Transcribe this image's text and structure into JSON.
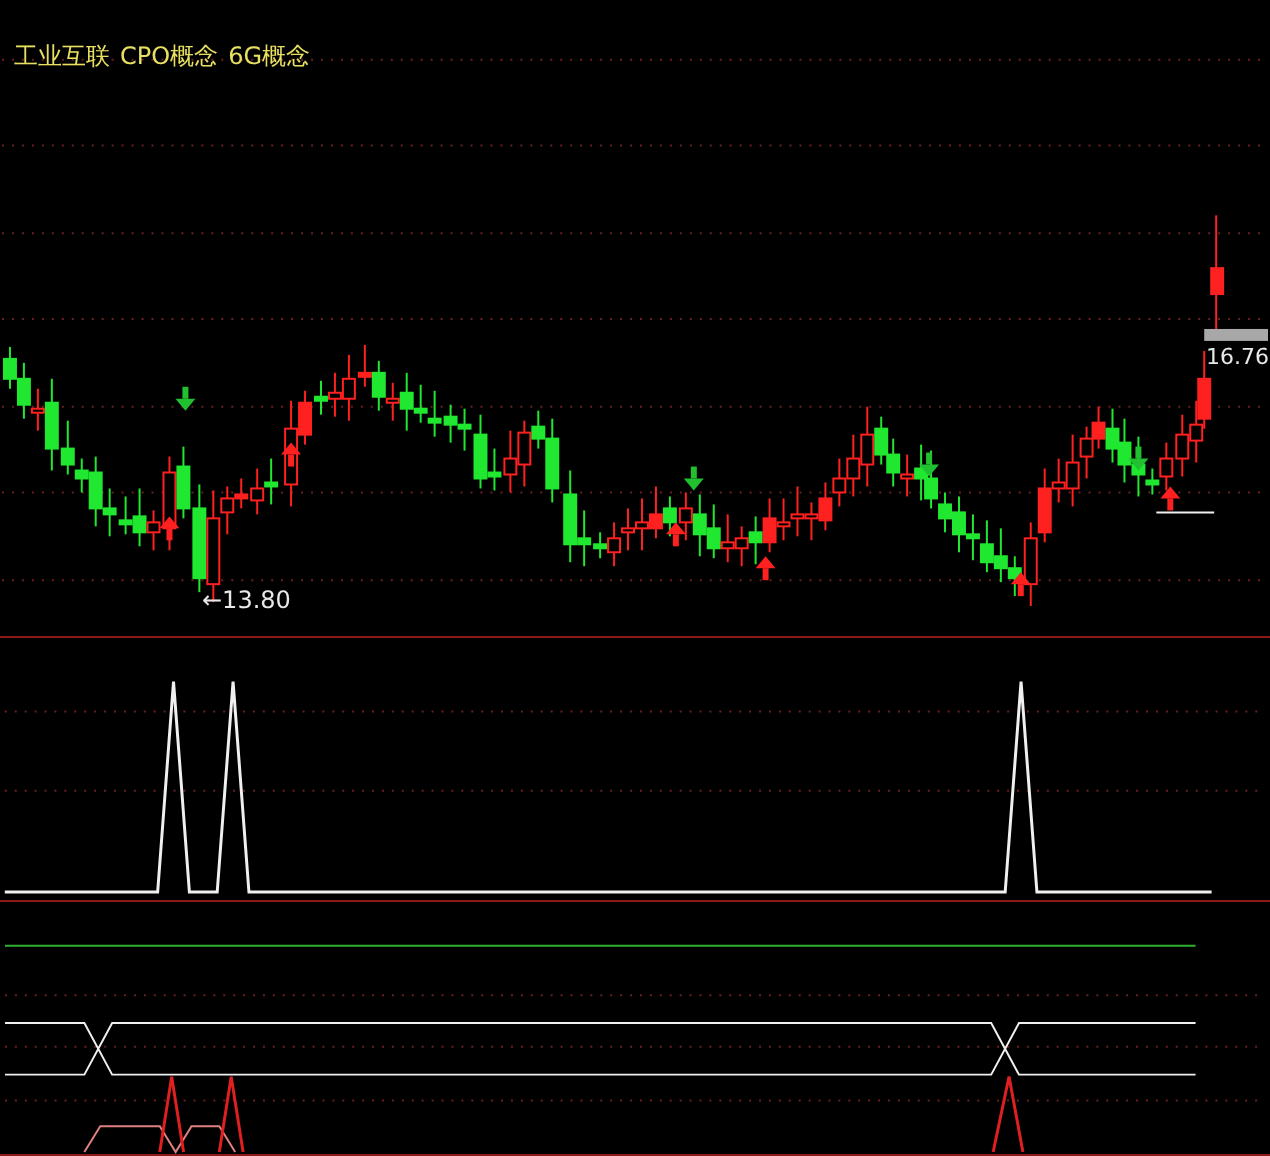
{
  "header": {
    "tags": [
      "工业互联",
      "CPO概念",
      "6G概念"
    ]
  },
  "price_panel": {
    "low_label": "←13.80",
    "last_price": "16.76"
  }
}
